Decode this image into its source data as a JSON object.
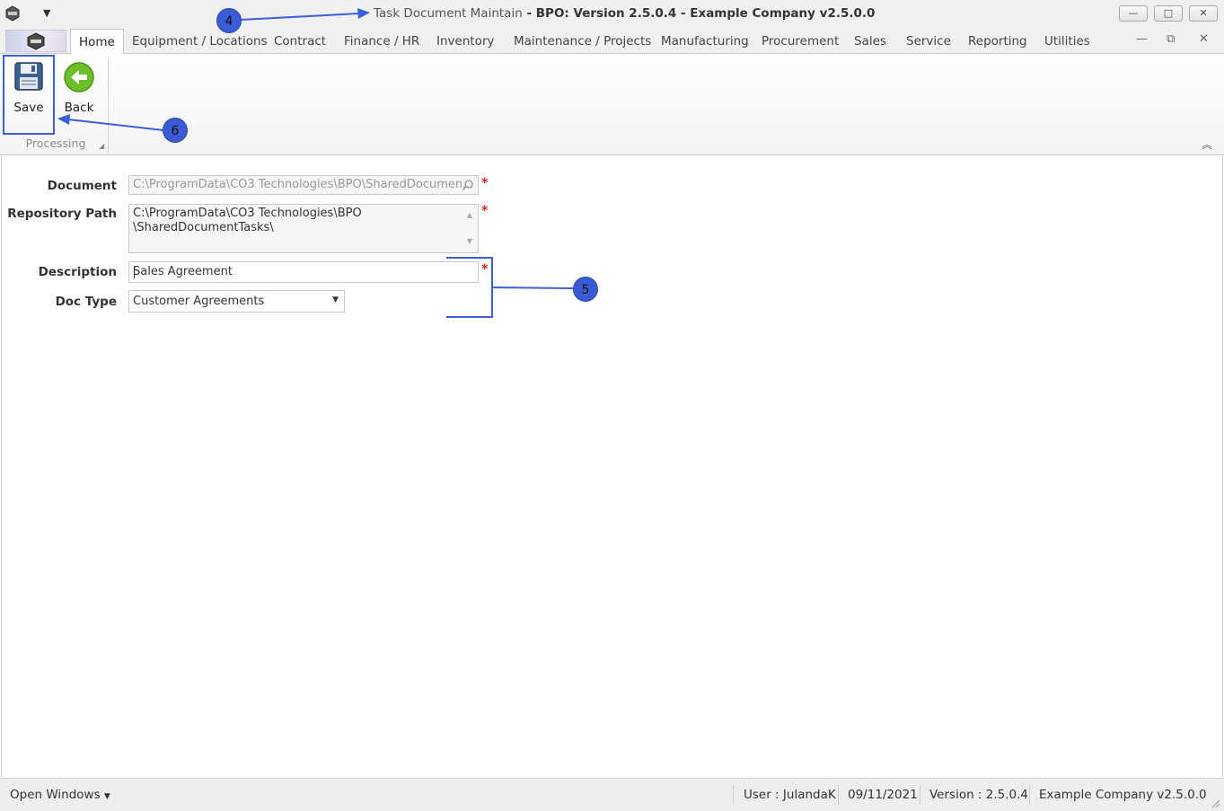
{
  "window": {
    "title_prefix": "Task Document Maintain",
    "title_rest": " - BPO: Version 2.5.0.4 - Example Company v2.5.0.0",
    "minimize": "—",
    "maximize": "□",
    "close": "✕",
    "qat_dropdown": "▼"
  },
  "tabs": [
    {
      "label": "Home"
    },
    {
      "label": "Equipment / Locations"
    },
    {
      "label": "Contract"
    },
    {
      "label": "Finance / HR"
    },
    {
      "label": "Inventory"
    },
    {
      "label": "Maintenance / Projects"
    },
    {
      "label": "Manufacturing"
    },
    {
      "label": "Procurement"
    },
    {
      "label": "Sales"
    },
    {
      "label": "Service"
    },
    {
      "label": "Reporting"
    },
    {
      "label": "Utilities"
    }
  ],
  "mdi": {
    "minimize": "—",
    "restore": "⧉",
    "close": "✕"
  },
  "ribbon": {
    "save_label": "Save",
    "back_label": "Back",
    "group_label": "Processing",
    "collapse": "︽"
  },
  "form": {
    "document_label": "Document",
    "document_value": "C:\\ProgramData\\CO3 Technologies\\BPO\\SharedDocumen...",
    "repo_label": "Repository Path",
    "repo_line1": "C:\\ProgramData\\CO3 Technologies\\BPO",
    "repo_line2": "\\SharedDocumentTasks\\",
    "description_label": "Description",
    "description_value": "Sales Agreement",
    "doctype_label": "Doc Type",
    "doctype_value": "Customer Agreements",
    "required_mark": "*"
  },
  "annotations": {
    "n4": "4",
    "n5": "5",
    "n6": "6"
  },
  "statusbar": {
    "open_windows": "Open Windows",
    "user": "User : JulandaK",
    "date": "09/11/2021",
    "version": "Version : 2.5.0.4",
    "company": "Example Company v2.5.0.0"
  },
  "colors": {
    "annotation_blue": "#3b5fd9",
    "required_red": "#e0201d",
    "back_green": "#6cbf2a"
  }
}
